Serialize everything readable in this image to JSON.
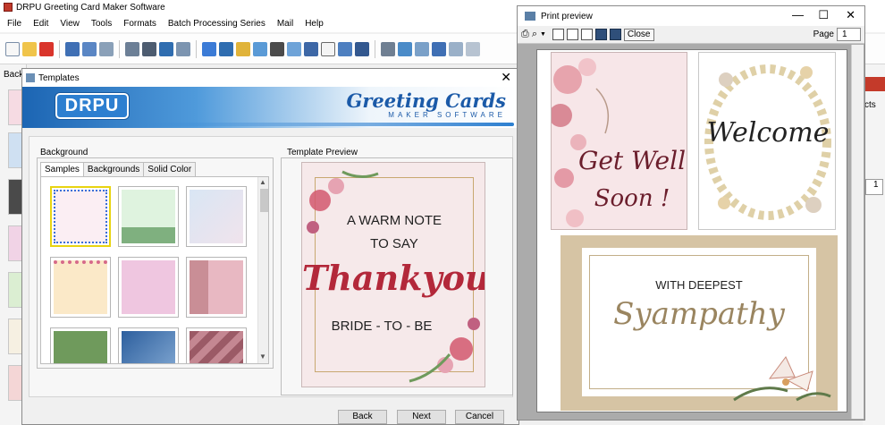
{
  "app": {
    "title": "DRPU Greeting Card Maker Software",
    "menu": [
      "File",
      "Edit",
      "View",
      "Tools",
      "Formats",
      "Batch Processing Series",
      "Mail",
      "Help"
    ],
    "left_label": "Back"
  },
  "right_peek": {
    "text": "cts",
    "spinner_value": "1"
  },
  "templates_dialog": {
    "title": "Templates",
    "logo_text": "DRPU",
    "brand_main": "Greeting Cards",
    "brand_sub": "MAKER SOFTWARE",
    "background_group_label": "Background",
    "tabs": [
      "Samples",
      "Backgrounds",
      "Solid Color"
    ],
    "active_tab": "Samples",
    "preview_group_label": "Template Preview",
    "preview_card": {
      "line1": "A WARM NOTE",
      "line2": "TO SAY",
      "line3": "Thankyou",
      "line4": "BRIDE - TO - BE"
    },
    "buttons": {
      "back": "Back",
      "next": "Next",
      "cancel": "Cancel"
    },
    "thumb_colors": [
      "#fbeef3",
      "#dff3df",
      "#f0e3ec",
      "#fbe9c8",
      "#efc6e0",
      "#c98e96",
      "#6f9a5c",
      "#2d5f9e",
      "#9b5a66"
    ]
  },
  "print_preview": {
    "title": "Print preview",
    "close_label": "Close",
    "page_label": "Page",
    "page_value": "1",
    "cards": {
      "get_well_line1": "Get Well",
      "get_well_line2": "Soon !",
      "welcome": "Welcome",
      "sympathy_line1": "WITH DEEPEST",
      "sympathy_line2": "Syampathy"
    }
  },
  "colors": {
    "accent_blue": "#1b5aa8",
    "thankyou_red": "#b3283a",
    "getwell_maroon": "#6b1e2c",
    "sympathy_gold": "#9a8560",
    "card_tan": "#d6c4a4"
  }
}
